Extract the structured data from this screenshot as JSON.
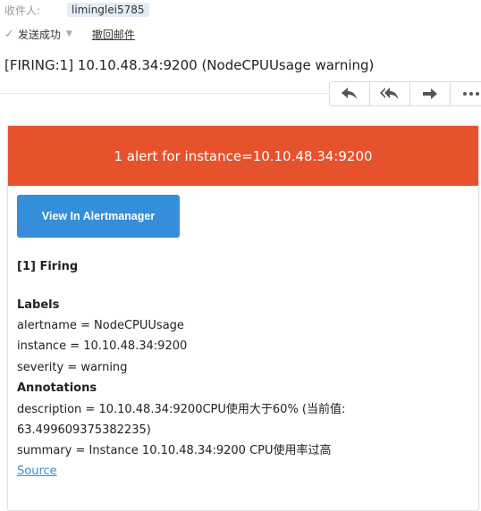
{
  "recipient": {
    "label": "收件人:",
    "name": "liminglei5785"
  },
  "status": {
    "sent_text": "发送成功",
    "recall_link": "撤回邮件"
  },
  "subject": "[FIRING:1] 10.10.48.34:9200 (NodeCPUUsage warning)",
  "toolbar": {
    "icons": [
      "reply-icon",
      "reply-all-icon",
      "forward-icon",
      "more-icon"
    ]
  },
  "email": {
    "banner": "1 alert for instance=10.10.48.34:9200",
    "button_label": "View In Alertmanager",
    "firing_heading": "[1] Firing",
    "labels_heading": "Labels",
    "labels": [
      "alertname = NodeCPUUsage",
      "instance = 10.10.48.34:9200",
      "severity = warning"
    ],
    "annotations_heading": "Annotations",
    "annotations": [
      "description = 10.10.48.34:9200CPU使用大于60% (当前值:",
      "63.499609375382235)",
      "summary = Instance 10.10.48.34:9200 CPU使用率过高"
    ],
    "source_link": "Source"
  },
  "colors": {
    "banner": "#e6522c",
    "button": "#348eda",
    "link": "#348eda"
  }
}
